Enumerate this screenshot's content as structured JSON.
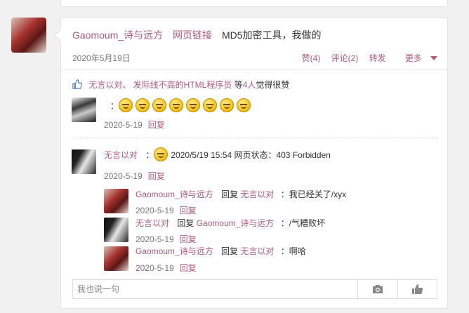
{
  "post": {
    "author": "Gaomoum_诗与远方",
    "link_label": "网页链接",
    "title": "MD5加密工具，我做的",
    "date": "2020年5月19日",
    "actions": {
      "like": "赞(4)",
      "comment": "评论(2)",
      "share": "转发",
      "more": "更多"
    }
  },
  "likes": {
    "users": "无言以对、 发际线不高的HTML程序员",
    "count_prefix": "等",
    "count": "4人",
    "suffix": "觉得很赞"
  },
  "comments": [
    {
      "author": "",
      "colon": "：",
      "emoji_count": 8,
      "date": "2020-5-19",
      "reply": "回复"
    },
    {
      "author": "无言以对",
      "colon": "：",
      "text": "2020/5/19 15:54 网页状态：403 Forbidden",
      "date": "2020-5-19",
      "reply": "回复"
    }
  ],
  "replies": [
    {
      "author": "Gaomoum_诗与远方",
      "verb": "回复",
      "target": "无言以对",
      "text": "：我已经关了/xyx",
      "date": "2020-5-19",
      "reply": "回复"
    },
    {
      "author": "无言以对",
      "verb": "回复",
      "target": "Gaomoum_诗与远方",
      "text": "：/气糟败坏",
      "date": "2020-5-19",
      "reply": "回复"
    },
    {
      "author": "Gaomoum_诗与远方",
      "verb": "回复",
      "target": "无言以对",
      "text": "：啊哈",
      "date": "2020-5-19",
      "reply": "回复"
    }
  ],
  "input": {
    "placeholder": "我也说一句",
    "camera_icon": "camera-icon",
    "thumb_icon": "thumbs-up-icon"
  },
  "colors": {
    "link": "#b0597a",
    "muted": "#777777"
  }
}
